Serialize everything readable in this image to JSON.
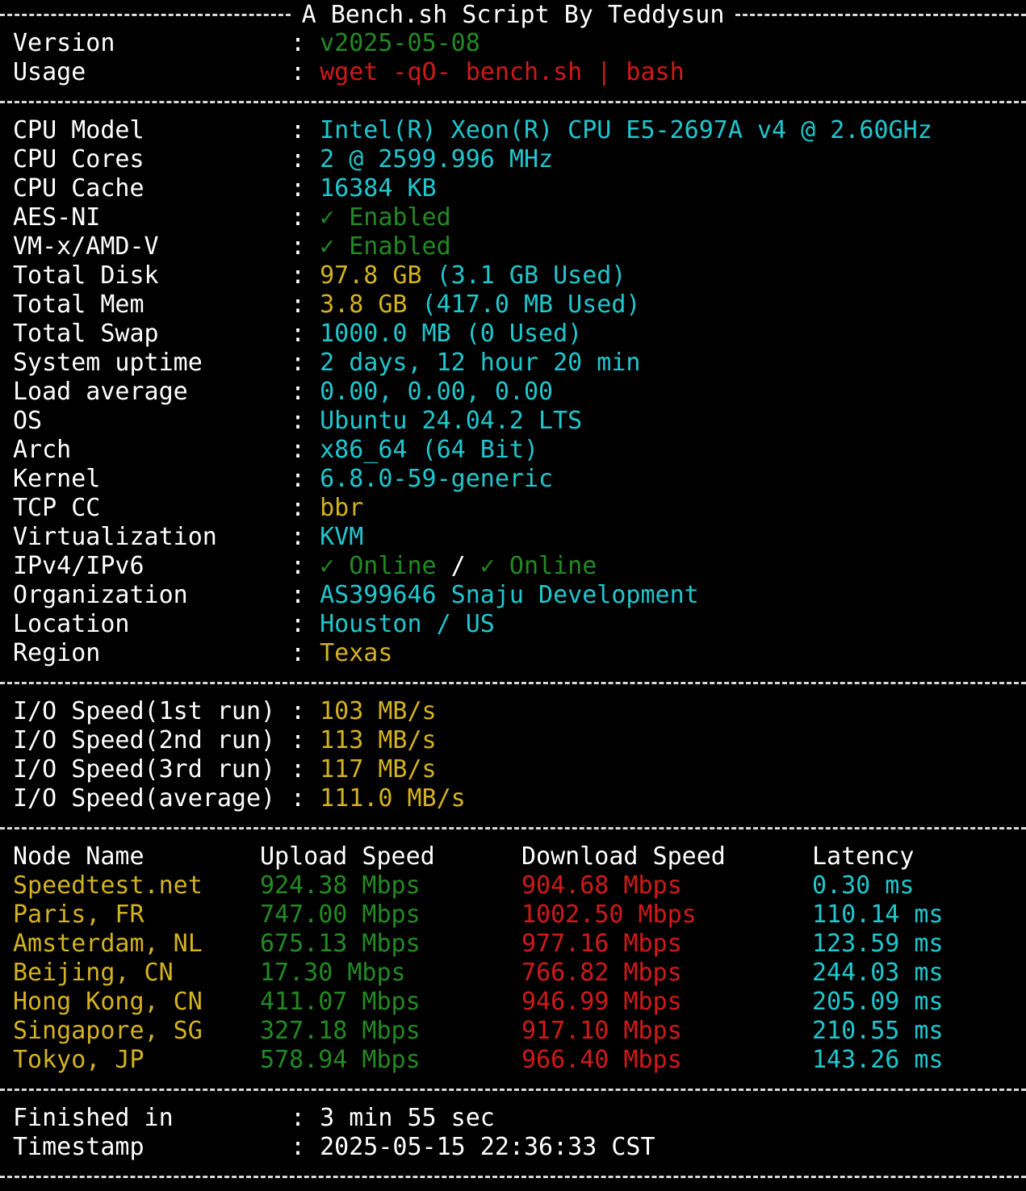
{
  "header_title": "A Bench.sh Script By Teddysun",
  "colon": ":",
  "meta": [
    {
      "label": "Version",
      "value": "v2025-05-08",
      "color": "#238a23"
    },
    {
      "label": "Usage",
      "value": "wget -qO- bench.sh | bash",
      "color": "#d11919"
    }
  ],
  "system": [
    {
      "label": "CPU Model",
      "value": "Intel(R) Xeon(R) CPU E5-2697A v4 @ 2.60GHz",
      "color": "#1fc7cf"
    },
    {
      "label": "CPU Cores",
      "value": "2 @ 2599.996 MHz",
      "color": "#1fc7cf"
    },
    {
      "label": "CPU Cache",
      "value": "16384 KB",
      "color": "#1fc7cf"
    },
    {
      "label": "AES-NI",
      "value": "✓ Enabled",
      "color": "#238a23"
    },
    {
      "label": "VM-x/AMD-V",
      "value": "✓ Enabled",
      "color": "#238a23"
    },
    {
      "label": "Total Disk",
      "value": "97.8 GB",
      "extra": " (3.1 GB Used)",
      "color": "#d4b21f",
      "extra_color": "#1fc7cf"
    },
    {
      "label": "Total Mem",
      "value": "3.8 GB",
      "extra": " (417.0 MB Used)",
      "color": "#d4b21f",
      "extra_color": "#1fc7cf"
    },
    {
      "label": "Total Swap",
      "value": "1000.0 MB (0 Used)",
      "color": "#1fc7cf"
    },
    {
      "label": "System uptime",
      "value": "2 days, 12 hour 20 min",
      "color": "#1fc7cf"
    },
    {
      "label": "Load average",
      "value": "0.00, 0.00, 0.00",
      "color": "#1fc7cf"
    },
    {
      "label": "OS",
      "value": "Ubuntu 24.04.2 LTS",
      "color": "#1fc7cf"
    },
    {
      "label": "Arch",
      "value": "x86_64 (64 Bit)",
      "color": "#1fc7cf"
    },
    {
      "label": "Kernel",
      "value": "6.8.0-59-generic",
      "color": "#1fc7cf"
    },
    {
      "label": "TCP CC",
      "value": "bbr",
      "color": "#d4b21f"
    },
    {
      "label": "Virtualization",
      "value": "KVM",
      "color": "#1fc7cf"
    },
    {
      "label": "IPv4/IPv6",
      "value": "✓ Online",
      "mid": " / ",
      "extra": "✓ Online",
      "color": "#238a23",
      "mid_color": "#ffffff",
      "extra_color": "#238a23"
    },
    {
      "label": "Organization",
      "value": "AS399646 Snaju Development",
      "color": "#1fc7cf"
    },
    {
      "label": "Location",
      "value": "Houston / US",
      "color": "#1fc7cf"
    },
    {
      "label": "Region",
      "value": "Texas",
      "color": "#d4b21f"
    }
  ],
  "io": [
    {
      "label": "I/O Speed(1st run)",
      "value": "103 MB/s",
      "color": "#d4b21f"
    },
    {
      "label": "I/O Speed(2nd run)",
      "value": "113 MB/s",
      "color": "#d4b21f"
    },
    {
      "label": "I/O Speed(3rd run)",
      "value": "117 MB/s",
      "color": "#d4b21f"
    },
    {
      "label": "I/O Speed(average)",
      "value": "111.0 MB/s",
      "color": "#d4b21f"
    }
  ],
  "speedtest": {
    "headers": [
      "Node Name",
      "Upload Speed",
      "Download Speed",
      "Latency"
    ],
    "rows": [
      {
        "node": "Speedtest.net",
        "upload": "924.38 Mbps",
        "download": "904.68 Mbps",
        "latency": "0.30 ms"
      },
      {
        "node": "Paris, FR",
        "upload": "747.00 Mbps",
        "download": "1002.50 Mbps",
        "latency": "110.14 ms"
      },
      {
        "node": "Amsterdam, NL",
        "upload": "675.13 Mbps",
        "download": "977.16 Mbps",
        "latency": "123.59 ms"
      },
      {
        "node": "Beijing, CN",
        "upload": "17.30 Mbps",
        "download": "766.82 Mbps",
        "latency": "244.03 ms"
      },
      {
        "node": "Hong Kong, CN",
        "upload": "411.07 Mbps",
        "download": "946.99 Mbps",
        "latency": "205.09 ms"
      },
      {
        "node": "Singapore, SG",
        "upload": "327.18 Mbps",
        "download": "917.10 Mbps",
        "latency": "210.55 ms"
      },
      {
        "node": "Tokyo, JP",
        "upload": "578.94 Mbps",
        "download": "966.40 Mbps",
        "latency": "143.26 ms"
      }
    ],
    "colors": {
      "node": "#d4b21f",
      "upload": "#238a23",
      "download": "#d11919",
      "latency": "#1fc7cf"
    }
  },
  "footer": [
    {
      "label": "Finished in",
      "value": "3 min 55 sec",
      "color": "#ffffff"
    },
    {
      "label": "Timestamp",
      "value": "2025-05-15 22:36:33 CST",
      "color": "#ffffff"
    }
  ]
}
